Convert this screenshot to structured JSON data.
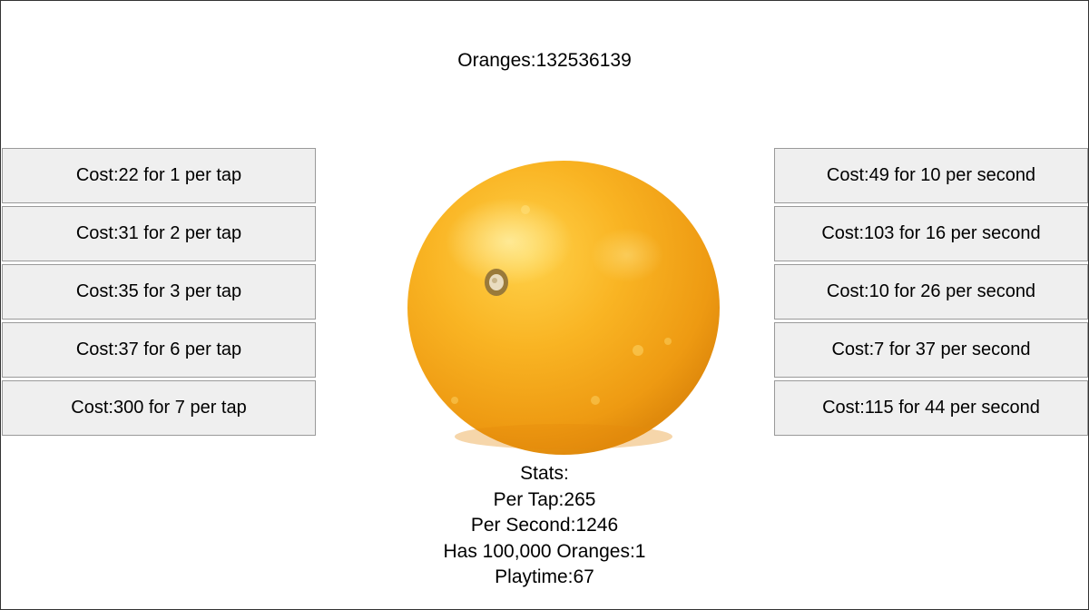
{
  "counter": {
    "text": "Oranges:132536139"
  },
  "tap_upgrades": [
    "Cost:22 for 1 per tap",
    "Cost:31 for 2 per tap",
    "Cost:35 for 3 per tap",
    "Cost:37 for 6 per tap",
    "Cost:300 for 7 per tap"
  ],
  "second_upgrades": [
    "Cost:49 for 10 per second",
    "Cost:103 for 16 per second",
    "Cost:10 for 26 per second",
    "Cost:7 for 37 per second",
    "Cost:115 for 44 per second"
  ],
  "stats": {
    "header": "Stats:",
    "per_tap": "Per Tap:265",
    "per_second": "Per Second:1246",
    "has_100k": "Has 100,000 Oranges:1",
    "playtime": "Playtime:67"
  },
  "orange": {
    "icon": "orange-fruit-icon",
    "color": "#f6a81c"
  }
}
